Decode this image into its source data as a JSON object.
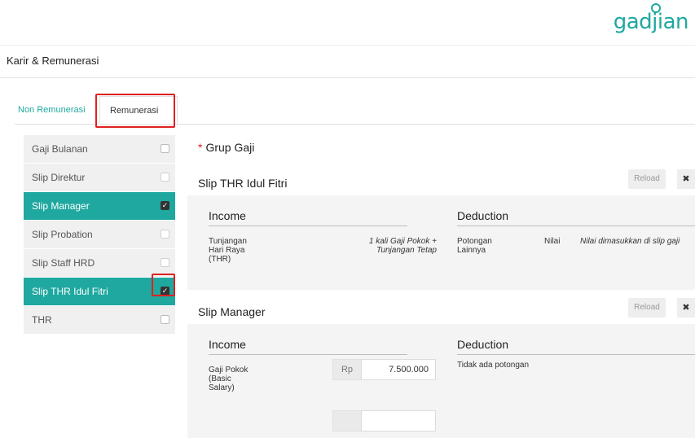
{
  "brand": {
    "logo_text": "gadjian",
    "accent": "#1fa8a0"
  },
  "section": {
    "title": "Karir & Remunerasi"
  },
  "tabs": [
    {
      "label": "Non Remunerasi",
      "active": false
    },
    {
      "label": "Remunerasi",
      "active": true
    }
  ],
  "slip_list": [
    {
      "label": "Gaji Bulanan",
      "checked": false,
      "active": false
    },
    {
      "label": "Slip Direktur",
      "checked": false,
      "active": false
    },
    {
      "label": "Slip Manager",
      "checked": true,
      "active": true
    },
    {
      "label": "Slip Probation",
      "checked": false,
      "active": false
    },
    {
      "label": "Slip Staff HRD",
      "checked": false,
      "active": false
    },
    {
      "label": "Slip THR Idul Fitri",
      "checked": true,
      "active": true
    },
    {
      "label": "THR",
      "checked": false,
      "active": false
    }
  ],
  "grup_gaji": {
    "required_mark": "*",
    "label": "Grup Gaji"
  },
  "slips": [
    {
      "title": "Slip THR Idul Fitri",
      "reload_label": "Reload",
      "close_icon": "✖",
      "income_header": "Income",
      "deduction_header": "Deduction",
      "income_name_lines": [
        "Tunjangan",
        "Hari Raya",
        "(THR)"
      ],
      "income_formula_lines": [
        "1 kali Gaji Pokok +",
        "Tunjangan Tetap"
      ],
      "deduction_name_lines": [
        "Potongan",
        "Lainnya"
      ],
      "deduction_nilai_label": "Nilai",
      "deduction_note": "Nilai dimasukkan di slip gaji"
    },
    {
      "title": "Slip Manager",
      "reload_label": "Reload",
      "close_icon": "✖",
      "income_header": "Income",
      "deduction_header": "Deduction",
      "income_name_lines": [
        "Gaji Pokok",
        "(Basic",
        "Salary)"
      ],
      "currency": "Rp",
      "amount": "7.500.000",
      "deduction_note": "Tidak ada potongan"
    }
  ]
}
